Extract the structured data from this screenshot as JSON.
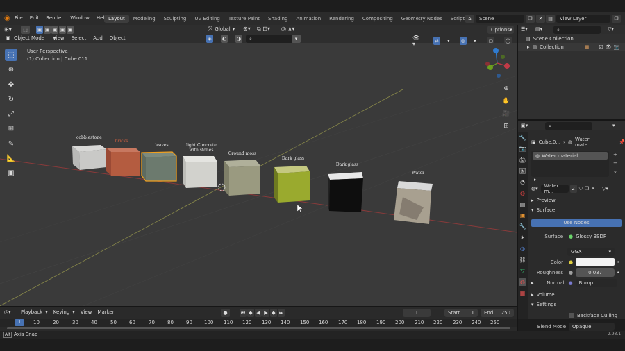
{
  "topbar": {
    "menus": [
      "File",
      "Edit",
      "Render",
      "Window",
      "Help"
    ],
    "workspaces": [
      "Layout",
      "Modeling",
      "Sculpting",
      "UV Editing",
      "Texture Paint",
      "Shading",
      "Animation",
      "Rendering",
      "Compositing",
      "Geometry Nodes",
      "Scripting"
    ],
    "scene": "Scene",
    "view_layer": "View Layer"
  },
  "tool_header": {
    "orientation": "Global",
    "options": "Options"
  },
  "viewport_header": {
    "mode": "Object Mode",
    "menus": [
      "View",
      "Select",
      "Add",
      "Object"
    ]
  },
  "viewport": {
    "perspective": "User Perspective",
    "context": "(1) Collection | Cube.011",
    "cube_labels": [
      "cobblestone",
      "bricks",
      "leaves",
      "light Concrete with stones",
      "Ground moss",
      "Dark glass",
      "Dark glass",
      "Water"
    ]
  },
  "outliner": {
    "scene_collection": "Scene Collection",
    "collection": "Collection"
  },
  "properties": {
    "object": "Cube.0...",
    "material": "Water mate...",
    "slot": "Water material",
    "mat_field": "Water m...",
    "user_count": "2",
    "preview": "Preview",
    "surface_panel": "Surface",
    "use_nodes": "Use Nodes",
    "surface_label": "Surface",
    "surface_value": "Glossy BSDF",
    "distribution": "GGX",
    "color_label": "Color",
    "roughness_label": "Roughness",
    "roughness_value": "0.037",
    "normal_label": "Normal",
    "normal_value": "Bump",
    "volume": "Volume",
    "settings": "Settings",
    "backface": "Backface Culling",
    "blend_label": "Blend Mode",
    "blend_value": "Opaque"
  },
  "timeline": {
    "menus": [
      "Playback",
      "Keying",
      "View",
      "Marker"
    ],
    "current_frame": "1",
    "start_label": "Start",
    "start_value": "1",
    "end_label": "End",
    "end_value": "250",
    "ruler": [
      "1",
      "10",
      "20",
      "30",
      "40",
      "50",
      "60",
      "70",
      "80",
      "90",
      "100",
      "110",
      "120",
      "130",
      "140",
      "150",
      "160",
      "170",
      "180",
      "190",
      "200",
      "210",
      "220",
      "230",
      "240",
      "250"
    ]
  },
  "status": {
    "left": "Axis Snap",
    "version": "2.93.1"
  },
  "colors": {
    "accent": "#4772b3",
    "viewport_bg": "#3a3a3a",
    "active_outline": "#f0a020"
  }
}
